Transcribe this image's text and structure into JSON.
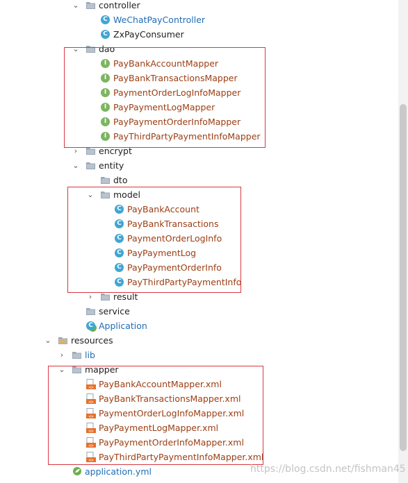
{
  "tree": {
    "controller": "controller",
    "controller_items": [
      "WeChatPayController",
      "ZxPayConsumer"
    ],
    "dao": "dao",
    "dao_items": [
      "PayBankAccountMapper",
      "PayBankTransactionsMapper",
      "PaymentOrderLogInfoMapper",
      "PayPaymentLogMapper",
      "PayPaymentOrderInfoMapper",
      "PayThirdPartyPaymentInfoMapper"
    ],
    "encrypt": "encrypt",
    "entity": "entity",
    "dto": "dto",
    "model": "model",
    "model_items": [
      "PayBankAccount",
      "PayBankTransactions",
      "PaymentOrderLogInfo",
      "PayPaymentLog",
      "PayPaymentOrderInfo",
      "PayThirdPartyPaymentInfo"
    ],
    "result": "result",
    "service": "service",
    "application": "Application",
    "resources": "resources",
    "lib": "lib",
    "mapper": "mapper",
    "mapper_items": [
      "PayBankAccountMapper.xml",
      "PayBankTransactionsMapper.xml",
      "PaymentOrderLogInfoMapper.xml",
      "PayPaymentLogMapper.xml",
      "PayPaymentOrderInfoMapper.xml",
      "PayThirdPartyPaymentInfoMapper.xml"
    ],
    "application_yml": "application.yml"
  },
  "icons": {
    "class": "class-icon",
    "interface": "interface-icon",
    "folder": "folder-icon",
    "xml": "xml-file-icon",
    "yml": "yml-file-icon",
    "spring_app": "spring-application-icon"
  },
  "watermark": "https://blog.csdn.net/fishman45",
  "colors": {
    "highlight_box": "#d9363e",
    "java_class_text": "#1e6db5",
    "mapper_text": "#9b3d12"
  }
}
